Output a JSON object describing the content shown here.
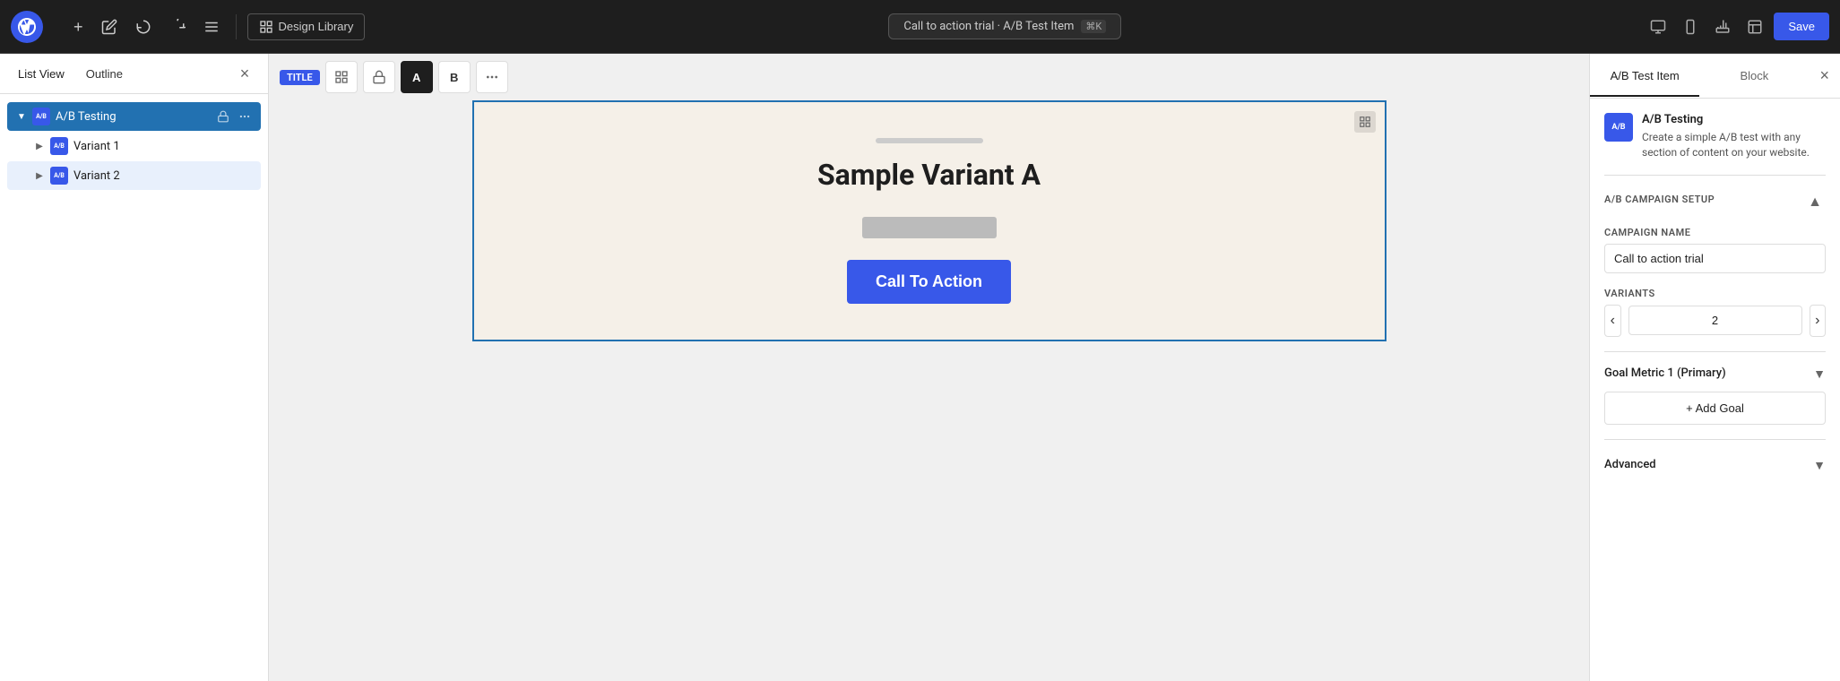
{
  "topbar": {
    "wp_logo": "W",
    "add_label": "+",
    "design_library_label": "Design Library",
    "title": "Call to action trial · A/B Test Item",
    "shortcut": "⌘K",
    "save_label": "Save"
  },
  "sidebar_left": {
    "tab_list_view": "List View",
    "tab_outline": "Outline",
    "tree": {
      "ab_testing_label": "A/B Testing",
      "variant1_label": "Variant 1",
      "variant2_label": "Variant 2"
    }
  },
  "canvas": {
    "block_title_badge": "TITLE",
    "variant_a_label": "A",
    "variant_b_label": "B",
    "sample_variant_title": "Sample Variant A",
    "cta_button_label": "Call To Action"
  },
  "sidebar_right": {
    "tab_ab_test_item": "A/B Test Item",
    "tab_block": "Block",
    "plugin_icon": "A/B",
    "plugin_title": "A/B Testing",
    "plugin_desc": "Create a simple A/B test with any section of content on your website.",
    "campaign_setup_label": "A/B Campaign Setup",
    "campaign_name_label": "CAMPAIGN NAME",
    "campaign_name_value": "Call to action trial",
    "variants_label": "Variants",
    "variants_value": "2",
    "prev_btn": "‹",
    "next_btn": "›",
    "goal_metric_label": "Goal Metric 1 (Primary)",
    "add_goal_label": "+ Add Goal",
    "advanced_label": "Advanced"
  }
}
